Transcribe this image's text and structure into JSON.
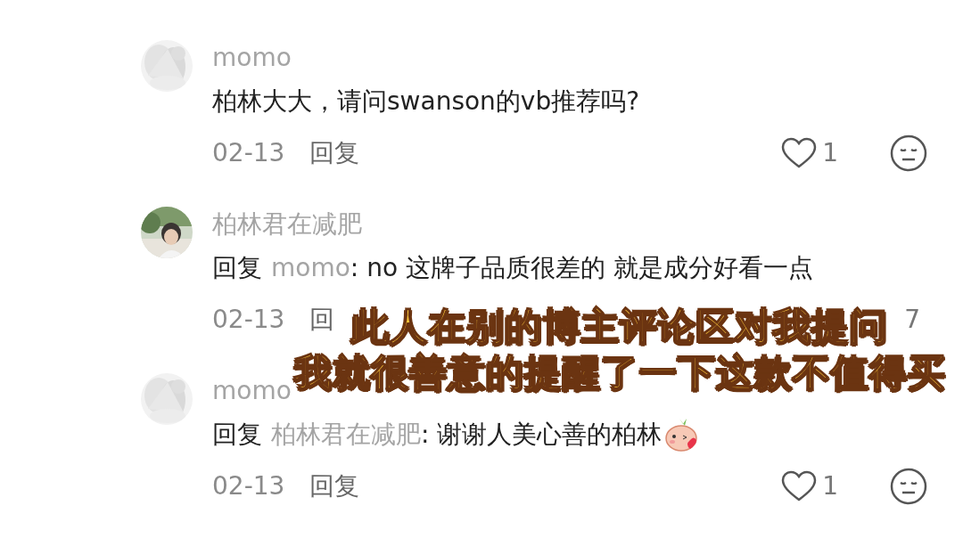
{
  "comments": [
    {
      "author": "momo",
      "text": "柏林大大，请问swanson的vb推荐吗?",
      "emoji": false,
      "date": "02-13",
      "reply_label": "回复",
      "heart": true,
      "likes": "1",
      "dislike": true
    },
    {
      "author": "柏林君在减肥",
      "reply_prefix": "回复",
      "reply_to": "momo",
      "text": ": no 这牌子品质很差的 就是成分好看一点",
      "emoji": false,
      "date": "02-13",
      "reply_label": "回",
      "heart": false,
      "likes": "7",
      "dislike": false
    },
    {
      "author": "momo",
      "reply_prefix": "回复",
      "reply_to": "柏林君在减肥",
      "text": ": 谢谢人美心善的柏林",
      "emoji": true,
      "date": "02-13",
      "reply_label": "回复",
      "heart": true,
      "likes": "1",
      "dislike": true
    }
  ],
  "caption": [
    "此人在别的博主评论区对我提问",
    "我就很善意的提醒了一下这款不值得买"
  ]
}
